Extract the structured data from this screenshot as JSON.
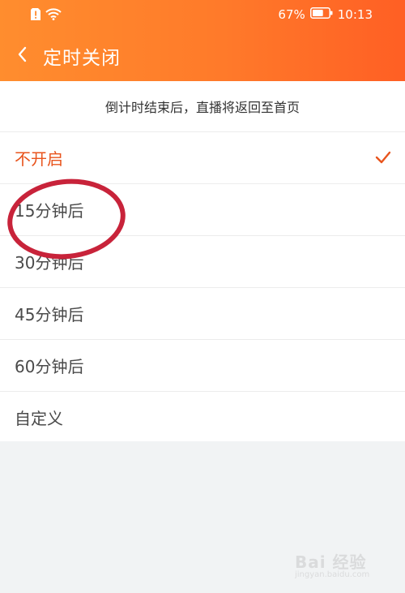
{
  "status_bar": {
    "battery_percent": "67%",
    "time": "10:13",
    "battery_level": 0.67
  },
  "nav": {
    "title": "定时关闭"
  },
  "notice": "倒计时结束后，直播将返回至首页",
  "options": [
    {
      "label": "不开启",
      "selected": true
    },
    {
      "label": "15分钟后",
      "selected": false
    },
    {
      "label": "30分钟后",
      "selected": false
    },
    {
      "label": "45分钟后",
      "selected": false
    },
    {
      "label": "60分钟后",
      "selected": false
    },
    {
      "label": "自定义",
      "selected": false
    }
  ],
  "colors": {
    "accent": "#e8541d",
    "header_start": "#ff8d2e",
    "header_end": "#ff5f24",
    "annotation": "#c8233a"
  },
  "icons": {
    "back": "chevron-left-icon",
    "check": "check-icon",
    "wifi": "wifi-icon",
    "battery": "battery-icon",
    "alert": "sim-alert-icon"
  },
  "watermark": {
    "brand": "Bai 经验",
    "url": "jingyan.baidu.com"
  }
}
